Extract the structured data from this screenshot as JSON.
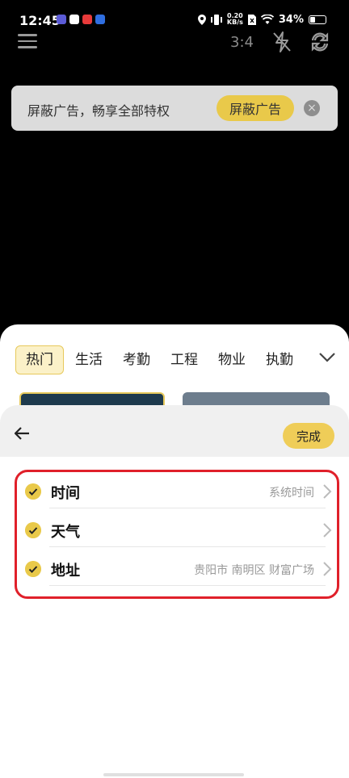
{
  "status_bar": {
    "time": "12:45",
    "net_speed_value": "0.20",
    "net_speed_unit": "KB/s",
    "battery": "34%",
    "app_icon_colors": [
      "#5b5bd6",
      "#e05a2b",
      "#e83a3a",
      "#2f6ee0"
    ]
  },
  "toolbar": {
    "ratio": "3:4",
    "icons": [
      "menu-icon",
      "flash-off-icon",
      "camera-switch-icon"
    ]
  },
  "ad_banner": {
    "text": "屏蔽广告，畅享全部特权",
    "button": "屏蔽广告",
    "close_glyph": "×"
  },
  "category_tabs": {
    "items": [
      "热门",
      "生活",
      "考勤",
      "工程",
      "物业",
      "执勤"
    ],
    "active_index": 0
  },
  "panel": {
    "done_label": "完成",
    "rows": [
      {
        "name": "时间",
        "value": "系统时间",
        "checked": true
      },
      {
        "name": "天气",
        "value": "",
        "checked": true
      },
      {
        "name": "地址",
        "value": "贵阳市 南明区 财富广场",
        "checked": true
      }
    ]
  },
  "colors": {
    "accent": "#e9c94a",
    "highlight_border": "#e0202a"
  }
}
